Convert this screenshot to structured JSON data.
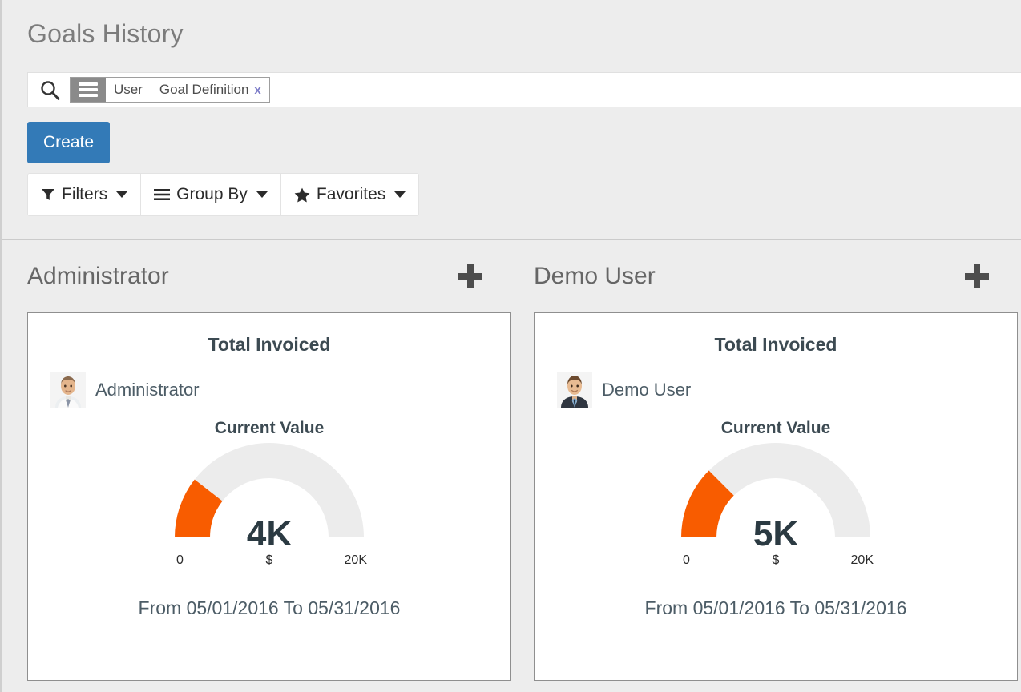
{
  "header": {
    "title": "Goals History"
  },
  "search": {
    "icon": "search-icon",
    "facet": {
      "icon": "hamburger-menu-icon",
      "group_label": "User",
      "value_label": "Goal Definition",
      "remove_label": "x"
    },
    "placeholder": ""
  },
  "toolbar": {
    "create_label": "Create",
    "filters_label": "Filters",
    "filters_icon": "funnel-icon",
    "group_by_label": "Group By",
    "group_by_icon": "hamburger-menu-icon",
    "favorites_label": "Favorites",
    "favorites_icon": "star-icon",
    "caret_icon": "caret-down-icon"
  },
  "colors": {
    "create_button": "#337ab7",
    "gauge_fill": "#f85c00",
    "gauge_track": "#ececec",
    "page_background": "#ededed",
    "facet_icon_background": "#8a8a8a",
    "facet_remove_link": "#7c7cc8"
  },
  "columns": [
    {
      "title": "Administrator",
      "add_icon": "plus-icon",
      "card": {
        "title": "Total Invoiced",
        "user_name": "Administrator",
        "avatar": "user-avatar",
        "subtitle": "Current Value",
        "range_text": "From 05/01/2016 To 05/31/2016"
      }
    },
    {
      "title": "Demo User",
      "add_icon": "plus-icon",
      "card": {
        "title": "Total Invoiced",
        "user_name": "Demo User",
        "avatar": "user-avatar",
        "subtitle": "Current Value",
        "range_text": "From 05/01/2016 To 05/31/2016"
      }
    }
  ],
  "chart_data": [
    {
      "type": "gauge",
      "title": "Total Invoiced",
      "subtitle": "Current Value",
      "owner": "Administrator",
      "value": 4000,
      "value_label": "4K",
      "min": 0,
      "min_label": "0",
      "max": 20000,
      "max_label": "20K",
      "unit_label": "$",
      "fill_fraction": 0.21,
      "fill_color": "#f85c00",
      "track_color": "#ececec",
      "period": "From 05/01/2016 To 05/31/2016"
    },
    {
      "type": "gauge",
      "title": "Total Invoiced",
      "subtitle": "Current Value",
      "owner": "Demo User",
      "value": 5000,
      "value_label": "5K",
      "min": 0,
      "min_label": "0",
      "max": 20000,
      "max_label": "20K",
      "unit_label": "$",
      "fill_fraction": 0.25,
      "fill_color": "#f85c00",
      "track_color": "#ececec",
      "period": "From 05/01/2016 To 05/31/2016"
    }
  ]
}
